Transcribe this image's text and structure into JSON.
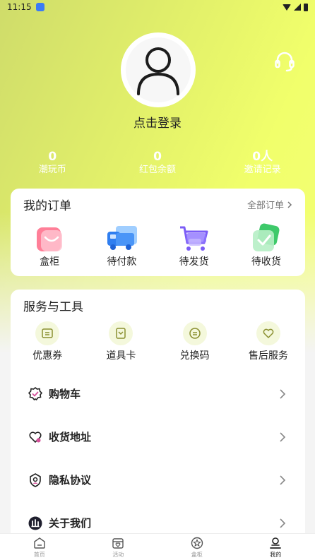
{
  "status_bar": {
    "time": "11:15"
  },
  "profile": {
    "login_text": "点击登录"
  },
  "stats": [
    {
      "value": "0",
      "label": "潮玩币"
    },
    {
      "value": "0",
      "label": "红包余额"
    },
    {
      "value": "0人",
      "label": "邀请记录"
    }
  ],
  "orders": {
    "title": "我的订单",
    "all_orders": "全部订单",
    "items": [
      {
        "label": "盒柜",
        "icon": "box-cabinet-icon",
        "color": "#ff6b86"
      },
      {
        "label": "待付款",
        "icon": "truck-icon",
        "color": "#3f8cf5"
      },
      {
        "label": "待发货",
        "icon": "cart-icon",
        "color": "#7b5cf6"
      },
      {
        "label": "待收货",
        "icon": "check-icon",
        "color": "#3ec96a"
      }
    ]
  },
  "services": {
    "title": "服务与工具",
    "items": [
      {
        "label": "优惠券",
        "icon": "coupon-icon"
      },
      {
        "label": "道具卡",
        "icon": "prop-card-icon"
      },
      {
        "label": "兑换码",
        "icon": "redeem-code-icon"
      },
      {
        "label": "售后服务",
        "icon": "after-sales-icon"
      }
    ],
    "list": [
      {
        "label": "购物车",
        "icon": "shopping-cart-badge-icon"
      },
      {
        "label": "收货地址",
        "icon": "address-heart-icon"
      },
      {
        "label": "隐私协议",
        "icon": "privacy-icon"
      },
      {
        "label": "关于我们",
        "icon": "about-icon"
      }
    ]
  },
  "bottom_nav": [
    {
      "label": "首页",
      "icon": "home-icon",
      "active": false
    },
    {
      "label": "活动",
      "icon": "activity-icon",
      "active": false
    },
    {
      "label": "盒柜",
      "icon": "star-badge-icon",
      "active": false
    },
    {
      "label": "我的",
      "icon": "profile-icon",
      "active": true
    }
  ],
  "colors": {
    "accent": "#ecfa6b",
    "text": "#222222"
  }
}
